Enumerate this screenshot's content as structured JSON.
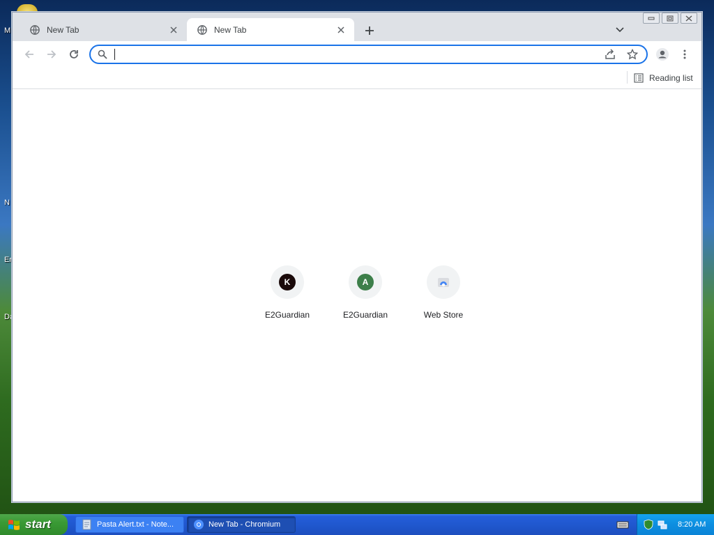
{
  "desktop": {
    "edge_labels": [
      "M",
      "N",
      "Er",
      "Da"
    ]
  },
  "browser": {
    "tabs": [
      {
        "title": "New Tab",
        "active": false
      },
      {
        "title": "New Tab",
        "active": true
      }
    ],
    "omnibox": {
      "value": "",
      "placeholder": ""
    },
    "bookmarks_bar": {
      "reading_list": "Reading list"
    },
    "shortcuts": [
      {
        "letter": "K",
        "label": "E2Guardian",
        "color": "#1a0a0a"
      },
      {
        "letter": "A",
        "label": "E2Guardian",
        "color": "#3d7f4a"
      },
      {
        "letter": "",
        "label": "Web Store",
        "color": "#4285f4"
      }
    ],
    "accent_color": "#1a73e8"
  },
  "taskbar": {
    "start_label": "start",
    "tasks": [
      {
        "label": "Pasta Alert.txt - Note...",
        "icon": "notepad-icon"
      },
      {
        "label": "New Tab - Chromium",
        "icon": "chromium-icon"
      }
    ],
    "clock": "8:20 AM"
  }
}
